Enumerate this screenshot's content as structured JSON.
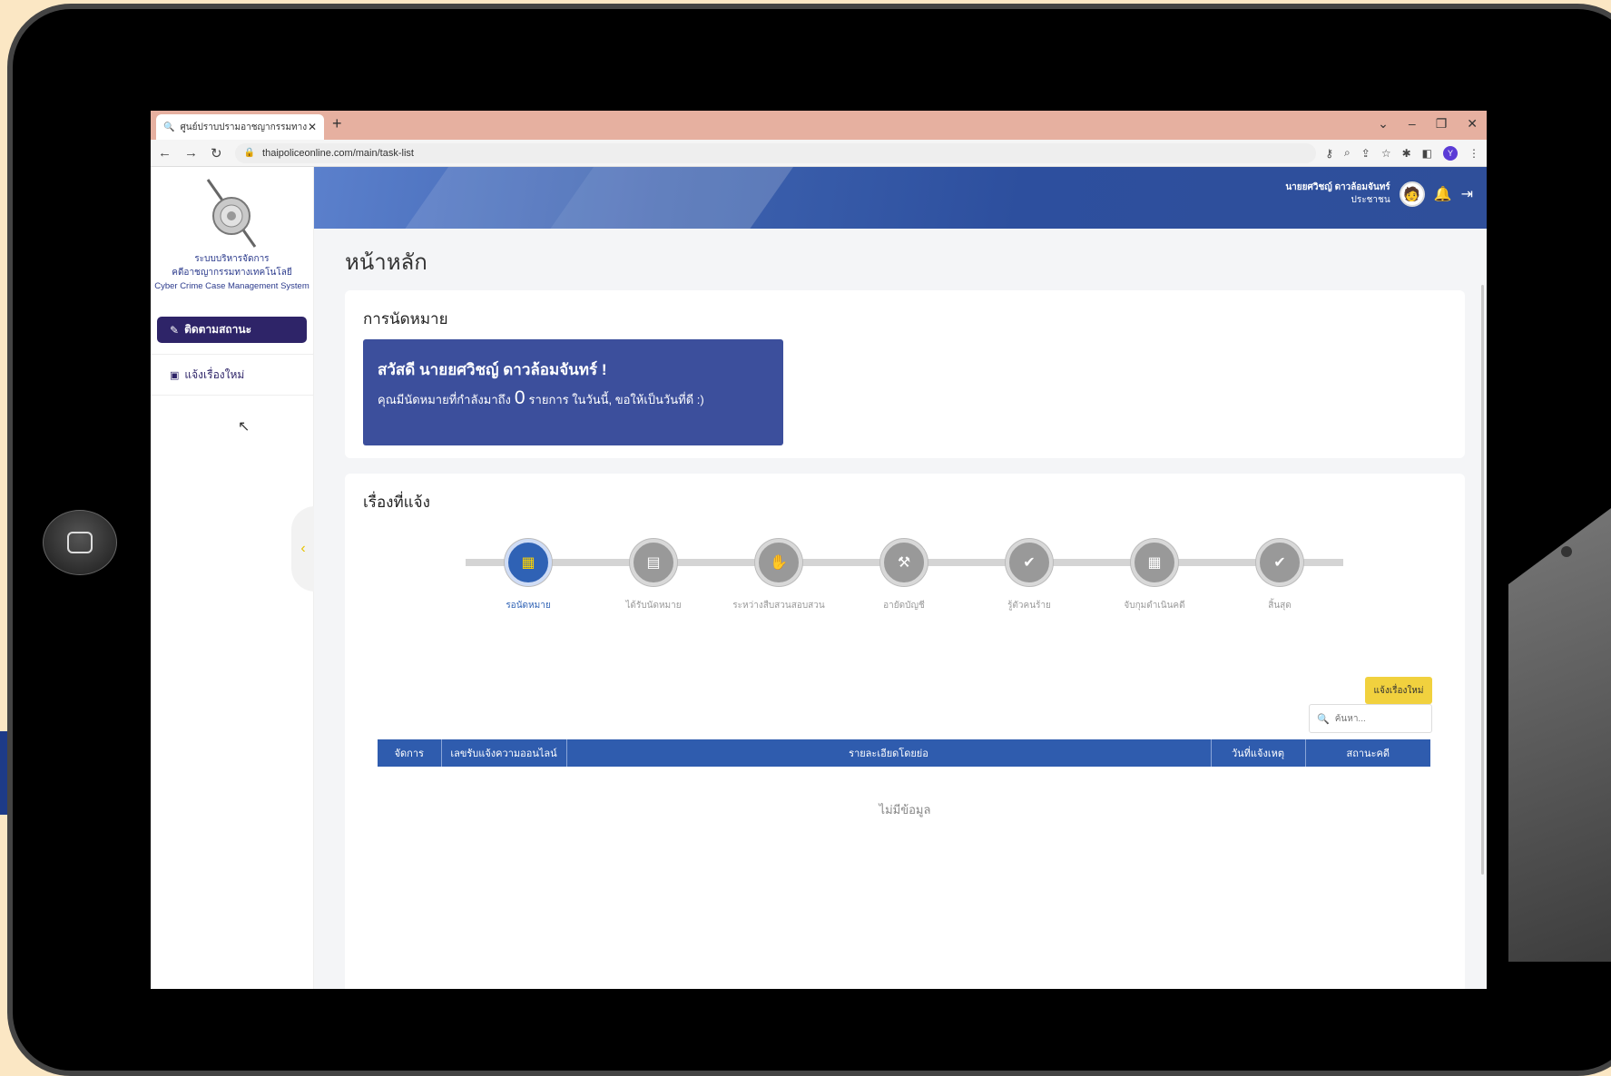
{
  "browser": {
    "tab_title": "ศูนย์ปราบปรามอาชญากรรมทางเทคโนโลยี",
    "url": "thaipoliceonline.com/main/task-list",
    "profile_initial": "Y"
  },
  "sidebar": {
    "org_line1": "ระบบบริหารจัดการ",
    "org_line2": "คดีอาชญากรรมทางเทคโนโลยี",
    "org_en": "Cyber Crime Case Management System",
    "menu_active": "ติดตามสถานะ",
    "menu_new_case": "แจ้งเรื่องใหม่"
  },
  "header": {
    "user_name": "นายยศวิชญ์ ดาวล้อมจันทร์",
    "user_role": "ประชาชน"
  },
  "page": {
    "title": "หน้าหลัก"
  },
  "appointments": {
    "title": "การนัดหมาย",
    "greeting": "สวัสดี นายยศวิชญ์ ดาวล้อมจันทร์ !",
    "msg_prefix": "คุณมีนัดหมายที่กำลังมาถึง",
    "count": "0",
    "msg_suffix": "รายการ ในวันนี้, ขอให้เป็นวันที่ดี :)"
  },
  "cases": {
    "title": "เรื่องที่แจ้ง",
    "steps": [
      {
        "label": "รอนัดหมาย",
        "icon": "calendar-icon"
      },
      {
        "label": "ได้รับนัดหมาย",
        "icon": "briefcase-icon"
      },
      {
        "label": "ระหว่างสืบสวนสอบสวน",
        "icon": "handshake-icon"
      },
      {
        "label": "อายัดบัญชี",
        "icon": "gavel-icon"
      },
      {
        "label": "รู้ตัวคนร้าย",
        "icon": "check-circle-icon"
      },
      {
        "label": "จับกุมดำเนินคดี",
        "icon": "calendar-icon"
      },
      {
        "label": "สิ้นสุด",
        "icon": "check-circle-icon"
      }
    ],
    "add_button": "แจ้งเรื่องใหม่",
    "search_placeholder": "ค้นหา...",
    "columns": [
      "จัดการ",
      "เลขรับแจ้งความออนไลน์",
      "รายละเอียดโดยย่อ",
      "วันที่แจ้งเหตุ",
      "สถานะคดี"
    ],
    "empty_text": "ไม่มีข้อมูล"
  },
  "colors": {
    "primary": "#2f5cae",
    "accent": "#f1d13e",
    "sidebar_active": "#2e2468"
  }
}
